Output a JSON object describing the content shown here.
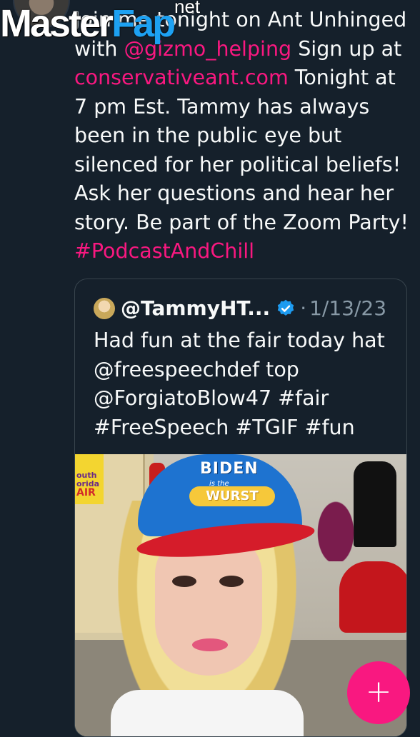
{
  "watermark": {
    "part1": "Master",
    "part2": "Fap",
    "suffix": "net"
  },
  "tweet": {
    "text_1": "Join me tonight on Ant Unhinged with ",
    "mention": "@gizmo_helping",
    "text_2": " Sign up at ",
    "link": "conservativeant.com",
    "text_3": " Tonight at 7 pm Est. Tammy has always been in the public eye but silenced for her political beliefs! Ask her questions and hear her story. Be part of the Zoom Party! ",
    "hashtag": "#PodcastAndChill"
  },
  "quote": {
    "handle": "@TammyHT...",
    "separator": "·",
    "date": "1/13/23",
    "line1": "Had fun at the fair today hat",
    "line2": "@freespeechdef top",
    "line3": "@ForgiatoBlow47 #fair",
    "line4": "#FreeSpeech #TGIF #fun",
    "photo_sign_line1": "outh",
    "photo_sign_line2": "orida",
    "photo_sign_line3": "AIR",
    "hat_line1": "BIDEN",
    "hat_line2": "is the",
    "hat_line3": "WURST"
  },
  "fab": {
    "label": "+"
  },
  "colors": {
    "background": "#15202b",
    "accent": "#f91880",
    "verified": "#1d9bf0",
    "muted": "#8899a6"
  }
}
